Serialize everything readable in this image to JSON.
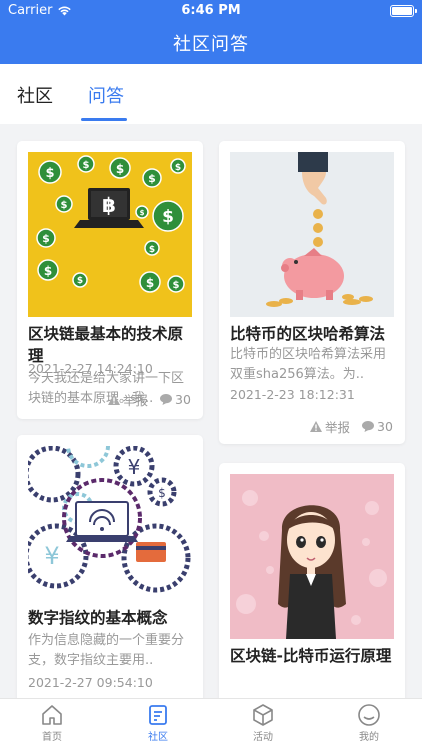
{
  "status_bar": {
    "carrier": "Carrier",
    "time": "6:46 PM"
  },
  "header": {
    "title": "社区问答"
  },
  "tabs": [
    {
      "label": "社区"
    },
    {
      "label": "问答"
    }
  ],
  "cards": [
    {
      "title": "区块链最基本的技术原理",
      "desc": "今天我还是给大家讲一下区块链的基本原理。我..",
      "date": "2021-2-27 14:24:10",
      "report": "举报",
      "comments": "30"
    },
    {
      "title": "比特币的区块哈希算法",
      "desc": "比特币的区块哈希算法采用双重sha256算法。为..",
      "date": "2021-2-23 18:12:31",
      "report": "举报",
      "comments": "30"
    },
    {
      "title": "数字指纹的基本概念",
      "desc": "作为信息隐藏的一个重要分支，数字指纹主要用..",
      "date": "2021-2-27 09:54:10"
    },
    {
      "title": "区块链-比特币运行原理"
    }
  ],
  "bottom_nav": [
    {
      "label": "首页",
      "icon": "home-icon"
    },
    {
      "label": "社区",
      "icon": "community-icon"
    },
    {
      "label": "活动",
      "icon": "box-icon"
    },
    {
      "label": "我的",
      "icon": "profile-icon"
    }
  ],
  "colors": {
    "accent": "#3a7bef",
    "header_bg": "#3a7bef",
    "muted_text": "#999999"
  }
}
